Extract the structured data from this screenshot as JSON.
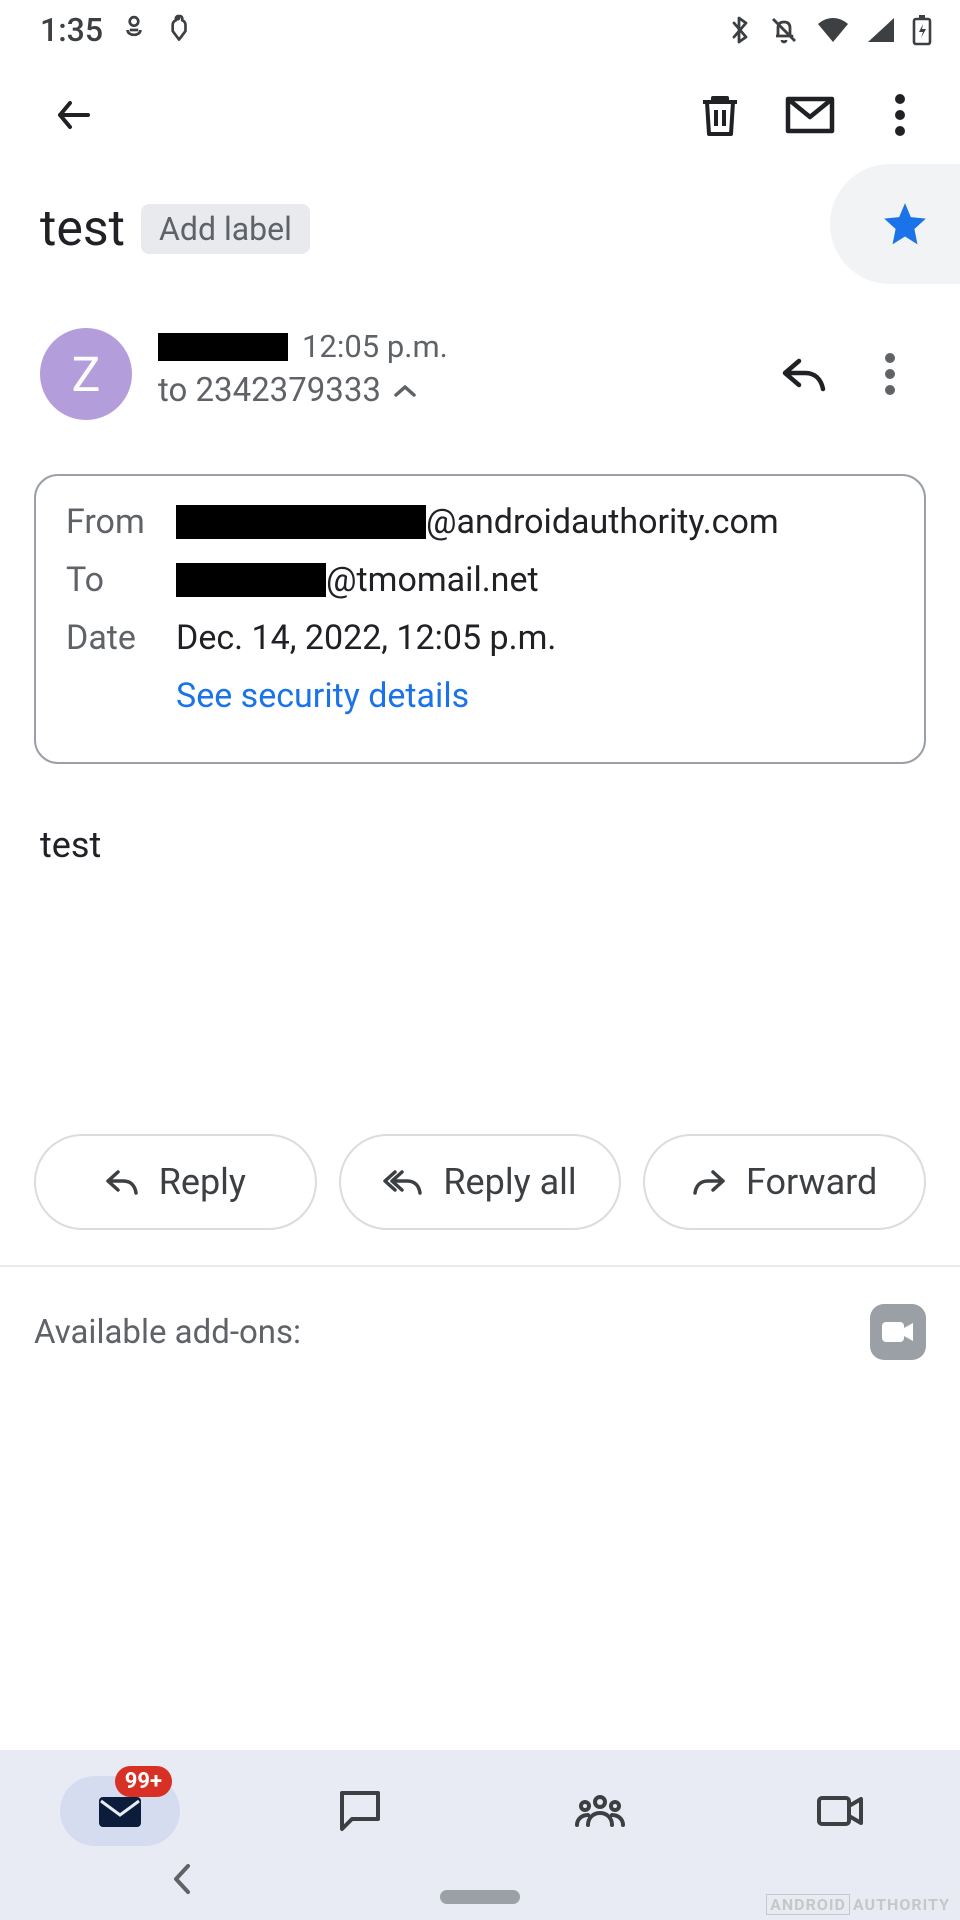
{
  "status": {
    "time": "1:35"
  },
  "subject": "test",
  "add_label": "Add label",
  "sender": {
    "avatar_letter": "Z",
    "time": "12:05 p.m.",
    "recipient_line": "to 2342379333"
  },
  "details": {
    "from_label": "From",
    "from_domain": "@androidauthority.com",
    "to_label": "To",
    "to_domain": "@tmomail.net",
    "date_label": "Date",
    "date_value": "Dec. 14, 2022, 12:05 p.m.",
    "security_link": "See security details"
  },
  "body": "test",
  "actions": {
    "reply": "Reply",
    "reply_all": "Reply all",
    "forward": "Forward"
  },
  "addons_label": "Available add-ons:",
  "nav": {
    "badge": "99+"
  },
  "watermark": {
    "a": "ANDROID",
    "b": "AUTHORITY"
  }
}
